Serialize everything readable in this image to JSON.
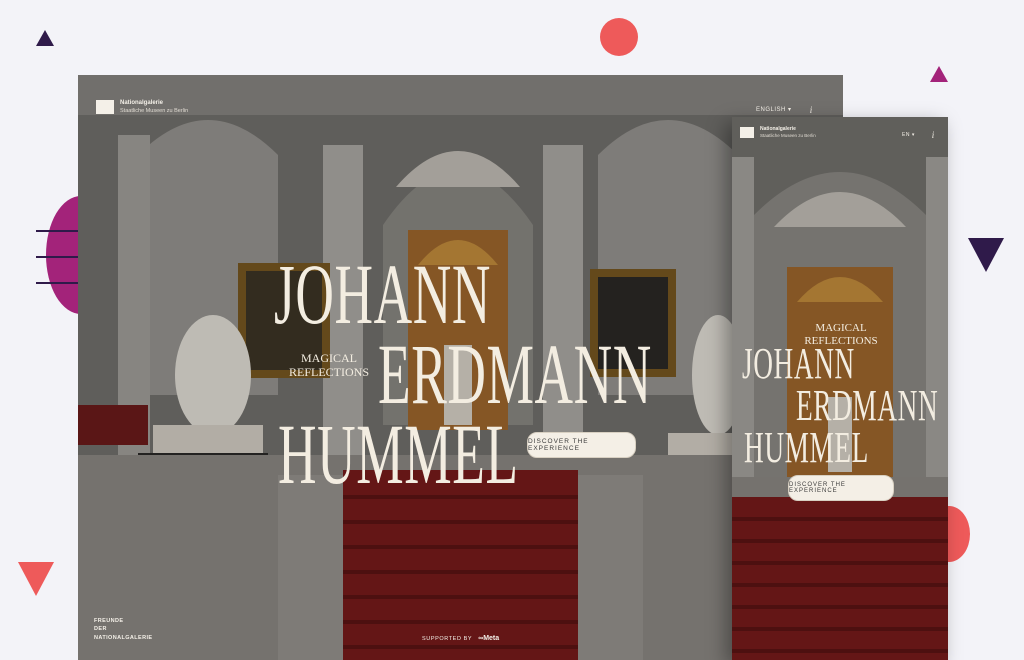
{
  "site": {
    "logo_name": "Nationalgalerie",
    "logo_subtitle": "Staatliche Museen zu Berlin"
  },
  "desktop": {
    "language": "ENGLISH",
    "title_lines": [
      "JOHANN",
      "ERDMANN",
      "HUMMEL"
    ],
    "subtitle_lines": [
      "MAGICAL",
      "REFLECTIONS"
    ],
    "cta_label": "DISCOVER THE EXPERIENCE",
    "friends_lines": [
      "FREUNDE",
      "DER",
      "NATIONALGALERIE"
    ],
    "supported_label": "SUPPORTED BY",
    "sponsor": "Meta",
    "info_icon": "i"
  },
  "mobile": {
    "language": "EN",
    "title_lines": [
      "JOHANN",
      "ERDMANN",
      "HUMMEL"
    ],
    "subtitle_lines": [
      "MAGICAL",
      "REFLECTIONS"
    ],
    "cta_label": "DISCOVER THE EXPERIENCE",
    "info_icon": "i"
  },
  "colors": {
    "background": "#f3f3f8",
    "accent_red": "#ee5a5a",
    "accent_magenta": "#a3237a",
    "accent_purple": "#2f1a4a",
    "carpet": "#7a1c1c",
    "text_cream": "#f3ede1"
  }
}
